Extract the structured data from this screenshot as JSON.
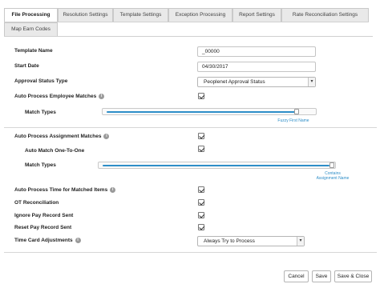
{
  "tabs": [
    {
      "label": "File Processing",
      "active": true
    },
    {
      "label": "Resolution Settings",
      "active": false
    },
    {
      "label": "Template Settings",
      "active": false
    },
    {
      "label": "Exception Processing",
      "active": false
    },
    {
      "label": "Report Settings",
      "active": false
    },
    {
      "label": "Rate Reconciliation Settings",
      "active": false
    },
    {
      "label": "Map Earn Codes",
      "active": false
    }
  ],
  "form": {
    "template_name": {
      "label": "Template Name",
      "value": "_00000"
    },
    "start_date": {
      "label": "Start Date",
      "value": "04/30/2017"
    },
    "approval_status_type": {
      "label": "Approval Status Type",
      "value": "Peoplenet Approval Status"
    },
    "auto_process_employee_matches": {
      "label": "Auto Process Employee Matches",
      "checked": true
    },
    "employee_match_types": {
      "label": "Match Types",
      "caption": "Fuzzy First Name",
      "level_percent": 90
    },
    "auto_process_assignment_matches": {
      "label": "Auto Process Assignment Matches",
      "checked": true
    },
    "auto_match_one_to_one": {
      "label": "Auto Match One-To-One",
      "checked": true
    },
    "assignment_match_types": {
      "label": "Match Types",
      "caption": "Contains Assignment Name",
      "level_percent": 100
    },
    "auto_process_time": {
      "label": "Auto Process Time for Matched Items",
      "checked": true
    },
    "ot_reconciliation": {
      "label": "OT Reconciliation",
      "checked": true
    },
    "ignore_pay_record_sent": {
      "label": "Ignore Pay Record Sent",
      "checked": true
    },
    "reset_pay_record_sent": {
      "label": "Reset Pay Record Sent",
      "checked": true
    },
    "time_card_adjustments": {
      "label": "Time Card Adjustments",
      "value": "Always Try to Process"
    }
  },
  "info_icon_glyph": "i",
  "select_arrow_glyph": "▾",
  "buttons": {
    "cancel": "Cancel",
    "save": "Save",
    "save_close": "Save & Close"
  },
  "colors": {
    "accent": "#2e8ec8"
  }
}
